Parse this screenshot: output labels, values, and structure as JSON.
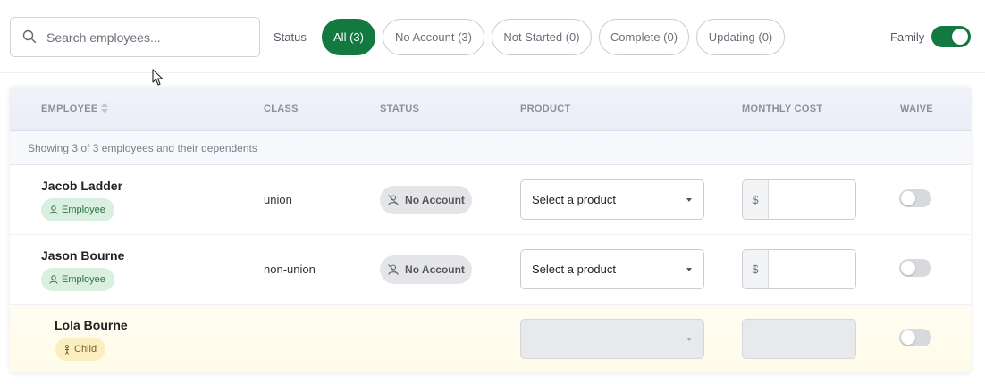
{
  "search": {
    "placeholder": "Search employees..."
  },
  "filters": {
    "label": "Status",
    "pills": [
      {
        "label": "All (3)",
        "active": true
      },
      {
        "label": "No Account (3)",
        "active": false
      },
      {
        "label": "Not Started (0)",
        "active": false
      },
      {
        "label": "Complete (0)",
        "active": false
      },
      {
        "label": "Updating (0)",
        "active": false
      }
    ]
  },
  "family": {
    "label": "Family",
    "on": true
  },
  "table": {
    "headers": [
      "EMPLOYEE",
      "CLASS",
      "STATUS",
      "PRODUCT",
      "MONTHLY COST",
      "WAIVE"
    ],
    "showing": "Showing 3 of 3 employees and their dependents",
    "rows": [
      {
        "name": "Jacob Ladder",
        "badge": "Employee",
        "class": "union",
        "status": "No Account",
        "product": "Select a product",
        "currency": "$",
        "waive": false
      },
      {
        "name": "Jason Bourne",
        "badge": "Employee",
        "class": "non-union",
        "status": "No Account",
        "product": "Select a product",
        "currency": "$",
        "waive": false
      },
      {
        "name": "Lola Bourne",
        "badge": "Child",
        "class": "",
        "status": "",
        "product": "",
        "currency": "",
        "waive": false
      }
    ]
  },
  "colors": {
    "accent": "#127a41",
    "child_badge": "#fbeec0",
    "employee_badge": "#d9efdf"
  },
  "icons": [
    "search-icon",
    "sort-icon",
    "user-icon",
    "no-account-icon",
    "child-icon",
    "cursor-icon"
  ]
}
